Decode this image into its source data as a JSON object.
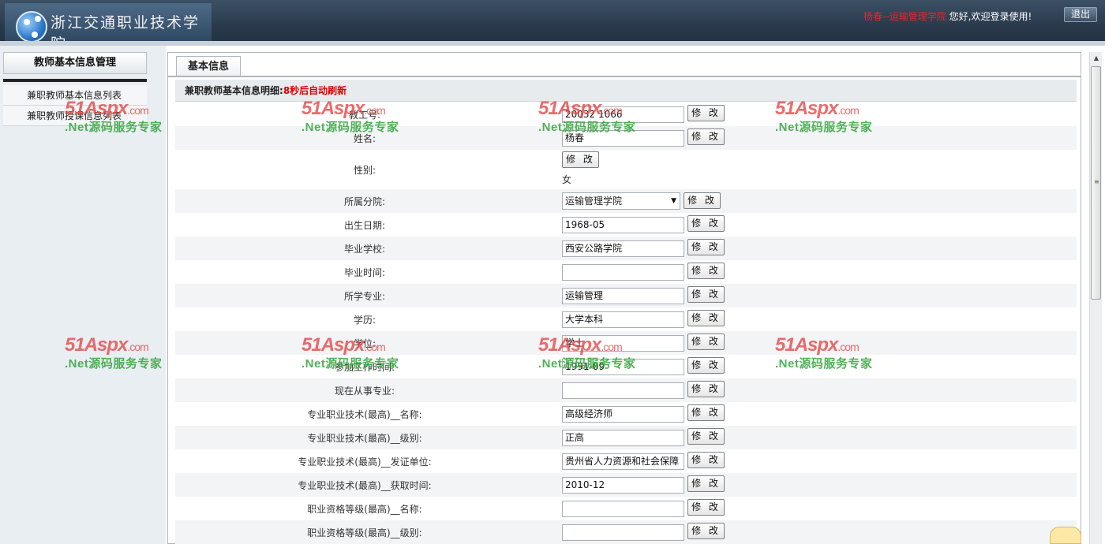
{
  "header": {
    "school_name": "浙江交通职业技术学院",
    "user_name": "杨春--运输管理学院",
    "welcome": "您好,欢迎登录使用!",
    "logout_label": "退出"
  },
  "sidebar": {
    "title": "教师基本信息管理",
    "items": [
      {
        "label": "兼职教师基本信息列表"
      },
      {
        "label": "兼职教师授课信息列表"
      }
    ]
  },
  "main": {
    "tab_label": "基本信息",
    "form_title": "兼职教师基本信息明细:",
    "refresh_text": "8秒后自动刷新",
    "edit_label": "修 改",
    "fields": [
      {
        "label": "教工号:",
        "value": "20032 1066"
      },
      {
        "label": "姓名:",
        "value": "杨春"
      },
      {
        "label": "性别:",
        "value": "女"
      },
      {
        "label": "所属分院:",
        "value": "运输管理学院"
      },
      {
        "label": "出生日期:",
        "value": "1968-05"
      },
      {
        "label": "毕业学校:",
        "value": "西安公路学院"
      },
      {
        "label": "毕业时间:",
        "value": ""
      },
      {
        "label": "所学专业:",
        "value": "运输管理"
      },
      {
        "label": "学历:",
        "value": "大学本科"
      },
      {
        "label": "学位:",
        "value": "学士"
      },
      {
        "label": "参加工作时间:",
        "value": "1991-09"
      },
      {
        "label": "现在从事专业:",
        "value": ""
      },
      {
        "label": "专业职业技术(最高)__名称:",
        "value": "高级经济师"
      },
      {
        "label": "专业职业技术(最高)__级别:",
        "value": "正高"
      },
      {
        "label": "专业职业技术(最高)__发证单位:",
        "value": "贵州省人力资源和社会保障"
      },
      {
        "label": "专业职业技术(最高)__获取时间:",
        "value": "2010-12"
      },
      {
        "label": "职业资格等级(最高)__名称:",
        "value": ""
      },
      {
        "label": "职业资格等级(最高)__级别:",
        "value": ""
      }
    ]
  },
  "watermark": {
    "brand": "51Aspx",
    "domain": ".com",
    "slogan": ".Net源码服务专家"
  }
}
